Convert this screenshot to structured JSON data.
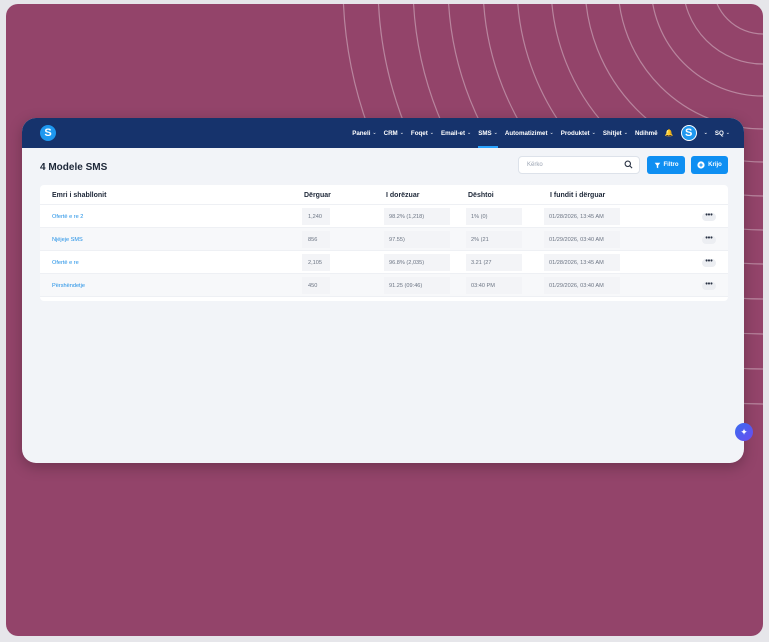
{
  "colors": {
    "brand": "#16336c",
    "accent": "#0f8ff2",
    "link": "#1f8fe6",
    "background": "#93446a"
  },
  "app": {
    "logo_letter": "S"
  },
  "nav": {
    "items": [
      {
        "label": "Paneli",
        "chevron": true
      },
      {
        "label": "CRM",
        "chevron": true
      },
      {
        "label": "Foqet",
        "chevron": true
      },
      {
        "label": "Email-et",
        "chevron": true
      },
      {
        "label": "SMS",
        "chevron": true,
        "active": true
      },
      {
        "label": "Automatizimet",
        "chevron": true
      },
      {
        "label": "Produktet",
        "chevron": true
      },
      {
        "label": "Shitjet",
        "chevron": true
      },
      {
        "label": "Ndihmë",
        "chevron": false
      }
    ],
    "avatar_letter": "S",
    "language": "SQ"
  },
  "page": {
    "title": "4 Modele SMS",
    "search_placeholder": "Kërko",
    "filter_label": "Filtro",
    "create_label": "Krijo"
  },
  "table": {
    "columns": [
      "Emri i shabllonit",
      "Dërguar",
      "I dorëzuar",
      "Dështoi",
      "I fundit i dërguar"
    ],
    "rows": [
      {
        "name": "Ofertë e re 2",
        "sent": "1,240",
        "delivered": "98.2% (1,218)",
        "failed": "1% (0)",
        "last_sent": "01/28/2026, 13:45 AM"
      },
      {
        "name": "Njëjeje SMS",
        "sent": "856",
        "delivered": "97.55)",
        "failed": "2% (21",
        "last_sent": "01/29/2026, 03:40 AM"
      },
      {
        "name": "Ofertë e re",
        "sent": "2,105",
        "delivered": "96.8% (2,035)",
        "failed": "3.21 (27",
        "last_sent": "01/28/2026, 13:45 AM"
      },
      {
        "name": "Përshëndetje",
        "sent": "450",
        "delivered": "91.25 (09:46)",
        "failed": "03:40 PM",
        "last_sent": "01/29/2026, 03:40 AM"
      }
    ],
    "row_action": "•••"
  },
  "icons": {
    "search": "search-icon",
    "filter": "filter-icon",
    "create": "plus-circle-icon",
    "bell": "bell-icon",
    "chevron": "chevron-down-icon",
    "assistant": "sparkle-icon"
  }
}
